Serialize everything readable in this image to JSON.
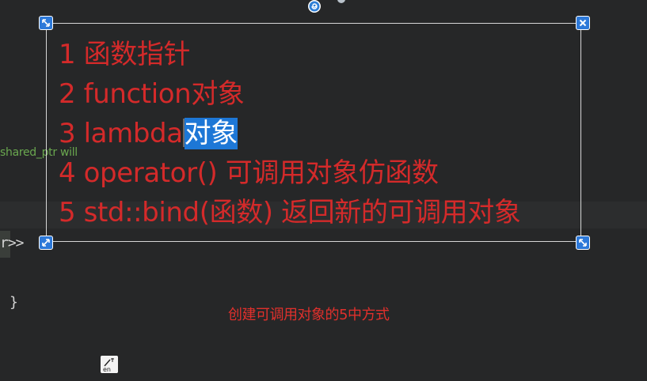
{
  "editor": {
    "comment_text": "shared_ptr will",
    "code_fragment": "r>>",
    "closing_brace": "}"
  },
  "annotation": {
    "lines": [
      "1 函数指针",
      "2 function对象",
      "3 lambda",
      "4 operator() 可调用对象仿函数",
      "5 std::bind(函数) 返回新的可调用对象"
    ],
    "line3_selected": "对象",
    "caption": "创建可调用对象的5中方式"
  },
  "ime": {
    "label": "en"
  },
  "colors": {
    "background": "#262728",
    "annotation_text": "#d42a2a",
    "selection": "#1d77d6",
    "handle": "#2d79d9",
    "caption": "#e0302c",
    "comment": "#6aa84f"
  },
  "icons": {
    "top": "spiral-icon",
    "handles": [
      "resize-handle-top-left",
      "close-handle-top-right",
      "resize-handle-bottom-left",
      "resize-handle-bottom-right"
    ],
    "ime": "ime-en-icon"
  }
}
